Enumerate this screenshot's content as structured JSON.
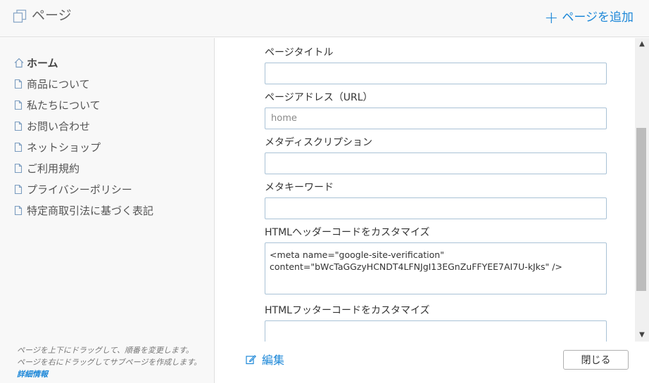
{
  "header": {
    "title": "ページ",
    "add_page_plus": "+",
    "add_page_label": "ページを追加"
  },
  "sidebar": {
    "items": [
      {
        "label": "ホーム",
        "icon": "home-icon"
      },
      {
        "label": "商品について",
        "icon": "page-icon"
      },
      {
        "label": "私たちについて",
        "icon": "page-icon"
      },
      {
        "label": "お問い合わせ",
        "icon": "page-icon"
      },
      {
        "label": "ネットショップ",
        "icon": "page-icon"
      },
      {
        "label": "ご利用規約",
        "icon": "page-icon"
      },
      {
        "label": "プライバシーポリシー",
        "icon": "page-icon"
      },
      {
        "label": "特定商取引法に基づく表記",
        "icon": "page-icon"
      }
    ],
    "help_line1": "ページを上下にドラッグして、順番を変更します。",
    "help_line2": "ページを右にドラッグしてサブページを作成します。",
    "help_link": "詳細情報"
  },
  "form": {
    "page_title_label": "ページタイトル",
    "page_title_value": "",
    "page_address_label": "ページアドレス（URL）",
    "page_address_placeholder": "home",
    "meta_description_label": "メタディスクリプション",
    "meta_description_value": "",
    "meta_keywords_label": "メタキーワード",
    "meta_keywords_value": "",
    "html_header_label": "HTMLヘッダーコードをカスタマイズ",
    "html_header_value": "<meta name=\"google-site-verification\" content=\"bWcTaGGzyHCNDT4LFNJgI13EGnZuFFYEE7AI7U-kJks\" />",
    "html_footer_label": "HTMLフッターコードをカスタマイズ",
    "html_footer_value": ""
  },
  "footer": {
    "edit_label": "編集",
    "close_label": "閉じる"
  },
  "colors": {
    "accent": "#1e88d8",
    "panel_bg": "#f8f8f8",
    "input_border": "#a9c2d6"
  }
}
